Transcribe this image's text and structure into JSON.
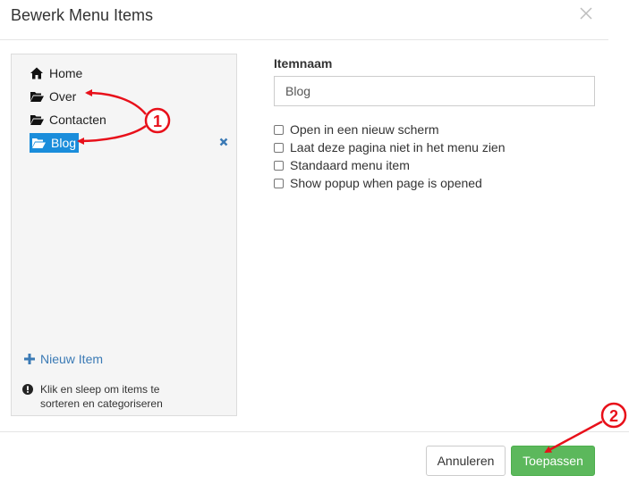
{
  "dialog": {
    "title": "Bewerk Menu Items"
  },
  "menu_tree": {
    "items": [
      {
        "label": "Home",
        "icon": "home-icon"
      },
      {
        "label": "Over",
        "icon": "folder-open-icon"
      },
      {
        "label": "Contacten",
        "icon": "folder-open-icon"
      },
      {
        "label": "Blog",
        "icon": "folder-open-icon",
        "selected": true
      }
    ],
    "new_item_label": "Nieuw Item",
    "hint_text": "Klik en sleep om items te sorteren en categoriseren"
  },
  "form": {
    "item_name_label": "Itemnaam",
    "item_name_value": "Blog",
    "options": [
      {
        "label": "Open in een nieuw scherm",
        "checked": false
      },
      {
        "label": "Laat deze pagina niet in het menu zien",
        "checked": false
      },
      {
        "label": "Standaard menu item",
        "checked": false
      },
      {
        "label": "Show popup when page is opened",
        "checked": false
      }
    ]
  },
  "footer": {
    "cancel_label": "Annuleren",
    "apply_label": "Toepassen"
  },
  "annotations": {
    "marker_1": "1",
    "marker_2": "2",
    "color": "#e8101a"
  },
  "colors": {
    "selected_bg": "#1a8ddb",
    "apply_button": "#5cb85c",
    "link": "#3b7ab5"
  }
}
